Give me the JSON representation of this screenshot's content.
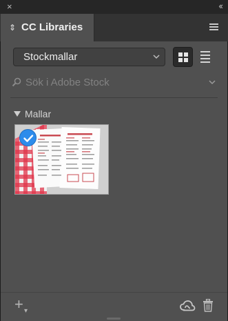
{
  "window": {
    "close_glyph": "×",
    "collapse_glyph": "‹‹"
  },
  "panel": {
    "tab_arrows": "⇕",
    "title": "CC Libraries",
    "menu_icon": "hamburger-menu-icon"
  },
  "library_dropdown": {
    "selected": "Stockmallar",
    "icon": "chevron-down-icon"
  },
  "view_toggle": {
    "active": "grid",
    "grid_icon": "grid-view-icon",
    "list_icon": "list-view-icon"
  },
  "search": {
    "placeholder": "Sök i Adobe Stock",
    "value": "",
    "icon": "search-icon"
  },
  "group": {
    "label": "Mallar",
    "expanded": true
  },
  "assets": [
    {
      "type": "menu-template-thumbnail",
      "selected": true
    }
  ],
  "footer": {
    "add_glyph": "+",
    "add_sub_glyph": "▾",
    "sync_icon": "creative-cloud-icon",
    "trash_icon": "trash-icon"
  },
  "colors": {
    "panel_bg": "#505050",
    "tabbar_bg": "#333333",
    "selection_blue": "#2d8ceb"
  }
}
